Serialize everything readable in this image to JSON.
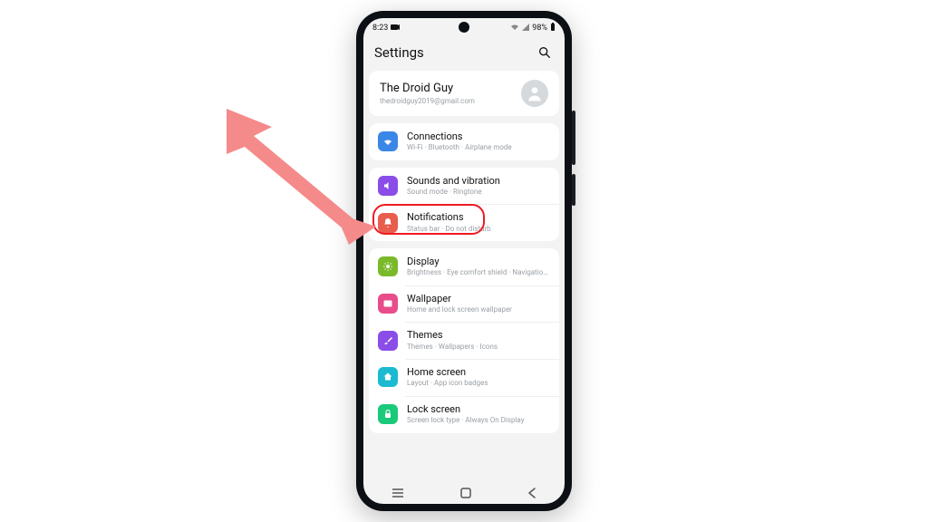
{
  "statusbar": {
    "time": "8:23",
    "battery": "98%"
  },
  "header": {
    "title": "Settings"
  },
  "account": {
    "name": "The Droid Guy",
    "email": "thedroidguy2019@gmail.com"
  },
  "groups": [
    {
      "items": [
        {
          "key": "connections",
          "label": "Connections",
          "sub": "Wi-Fi  ·  Bluetooth  ·  Airplane mode",
          "color": "#3b87e8",
          "icon": "wifi"
        }
      ]
    },
    {
      "items": [
        {
          "key": "sounds",
          "label": "Sounds and vibration",
          "sub": "Sound mode  ·  Ringtone",
          "color": "#8a4de8",
          "icon": "sound"
        },
        {
          "key": "notifications",
          "label": "Notifications",
          "sub": "Status bar  ·  Do not disturb",
          "color": "#e85d4d",
          "icon": "bell",
          "highlighted": true
        }
      ]
    },
    {
      "items": [
        {
          "key": "display",
          "label": "Display",
          "sub": "Brightness  ·  Eye comfort shield  ·  Navigation bar",
          "color": "#7ab929",
          "icon": "sun"
        },
        {
          "key": "wallpaper",
          "label": "Wallpaper",
          "sub": "Home and lock screen wallpaper",
          "color": "#e84d8a",
          "icon": "image"
        },
        {
          "key": "themes",
          "label": "Themes",
          "sub": "Themes  ·  Wallpapers  ·  Icons",
          "color": "#8a4de8",
          "icon": "brush"
        },
        {
          "key": "home",
          "label": "Home screen",
          "sub": "Layout  ·  App icon badges",
          "color": "#1bbad1",
          "icon": "home"
        },
        {
          "key": "lock",
          "label": "Lock screen",
          "sub": "Screen lock type  ·  Always On Display",
          "color": "#1bc97a",
          "icon": "lock"
        }
      ]
    }
  ],
  "annotation": {
    "arrow_color": "#f58a8a",
    "highlight_color": "#ee1b24"
  }
}
